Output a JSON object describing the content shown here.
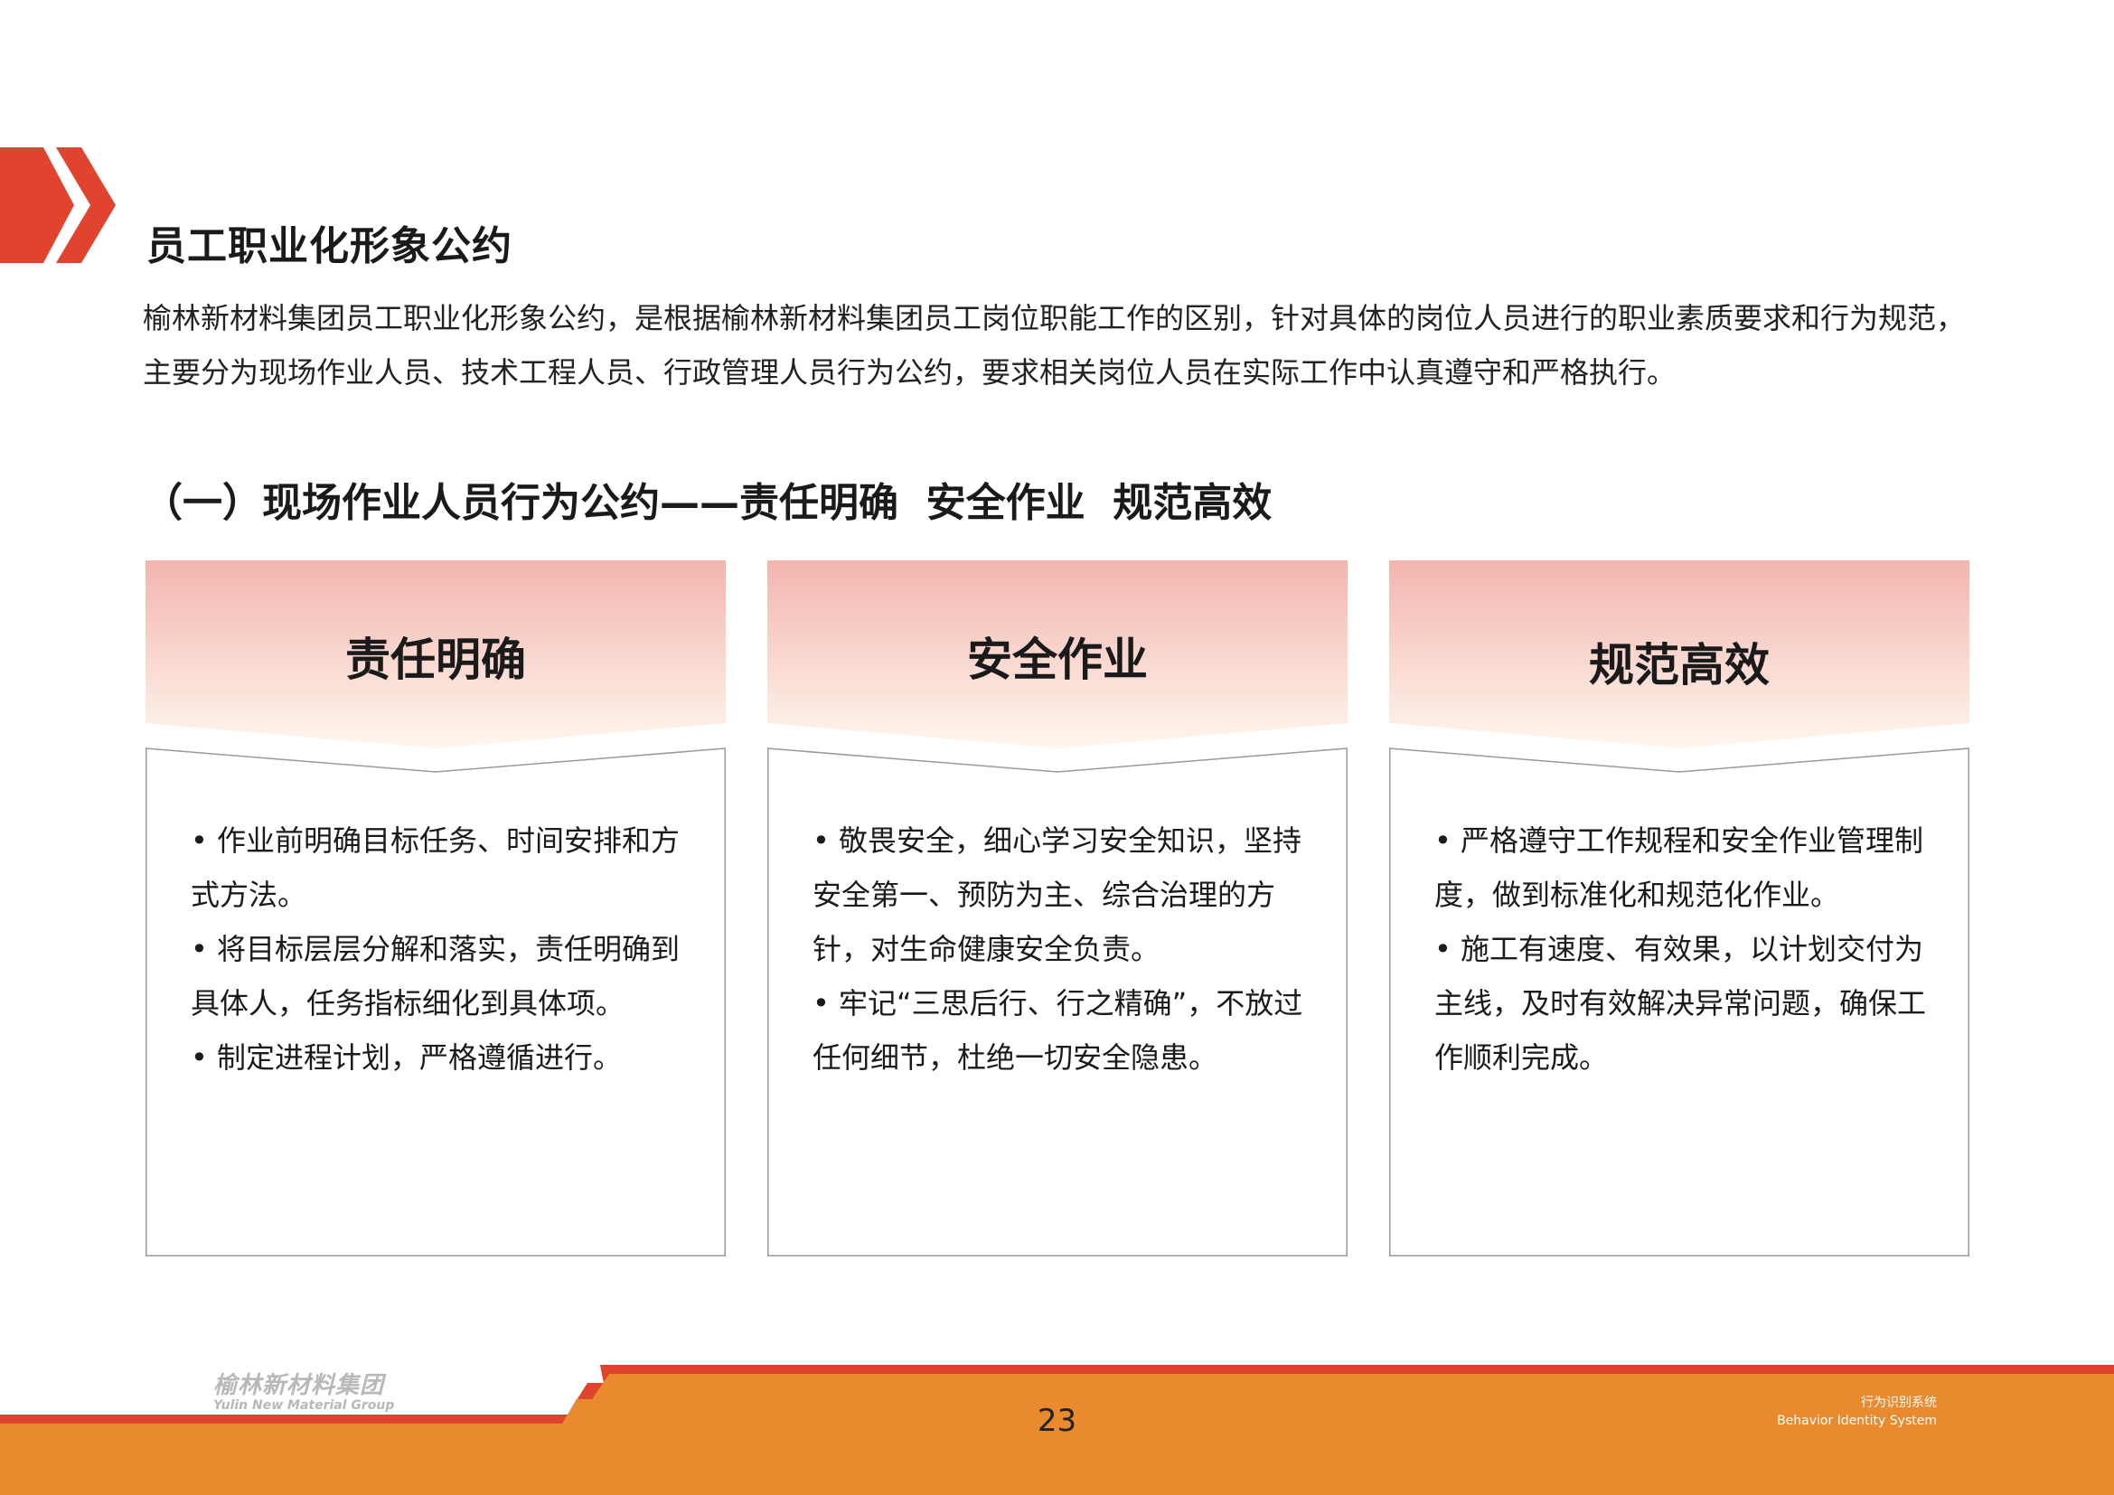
{
  "colors": {
    "accent_red": "#E0442E",
    "accent_orange": "#E88A2D",
    "header_gradient_top": "#F2B5AE",
    "header_gradient_bottom": "#FFF7EE"
  },
  "page": {
    "title": "员工职业化形象公约",
    "intro": "榆林新材料集团员工职业化形象公约，是根据榆林新材料集团员工岗位职能工作的区别，针对具体的岗位人员进行的职业素质要求和行为规范，主要分为现场作业人员、技术工程人员、行政管理人员行为公约，要求相关岗位人员在实际工作中认真遵守和严格执行。",
    "section_heading": "（一）现场作业人员行为公约——责任明确  安全作业  规范高效"
  },
  "columns": [
    {
      "header": "责任明确",
      "bullets": [
        "• 作业前明确目标任务、时间安排和方式方法。",
        "• 将目标层层分解和落实，责任明确到具体人，任务指标细化到具体项。",
        "• 制定进程计划，严格遵循进行。"
      ]
    },
    {
      "header": "安全作业",
      "bullets": [
        "• 敬畏安全，细心学习安全知识，坚持安全第一、预防为主、综合治理的方针，对生命健康安全负责。",
        "• 牢记“三思后行、行之精确”，不放过任何细节，杜绝一切安全隐患。"
      ]
    },
    {
      "header": "规范高效",
      "bullets": [
        "• 严格遵守工作规程和安全作业管理制度，做到标准化和规范化作业。",
        "• 施工有速度、有效果，以计划交付为主线，及时有效解决异常问题，确保工作顺利完成。"
      ]
    }
  ],
  "footer": {
    "brand_cn": "榆林新材料集团",
    "brand_en": "Yulin New Material Group",
    "page_number": "23",
    "system_cn": "行为识别系统",
    "system_en": "Behavior Identity System"
  }
}
